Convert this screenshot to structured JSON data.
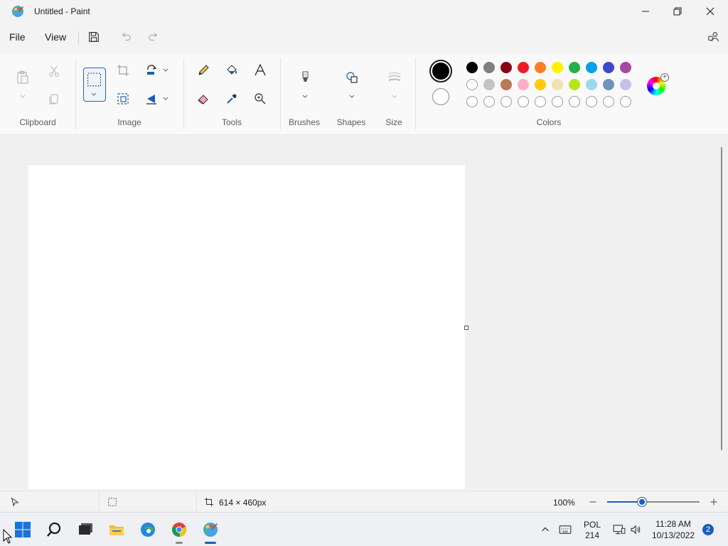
{
  "window": {
    "title": "Untitled - Paint"
  },
  "menu": {
    "file": "File",
    "view": "View"
  },
  "ribbon": {
    "groups": {
      "clipboard": "Clipboard",
      "image": "Image",
      "tools": "Tools",
      "brushes": "Brushes",
      "shapes": "Shapes",
      "size": "Size",
      "colors": "Colors"
    }
  },
  "colors": {
    "primary": "#000000",
    "secondary": "#ffffff",
    "row1": [
      "#000000",
      "#7f7f7f",
      "#880015",
      "#ed1c24",
      "#ff7f27",
      "#fff200",
      "#22b14c",
      "#00a2e8",
      "#3f48cc",
      "#a349a4"
    ],
    "row2": [
      "#ffffff",
      "#c3c3c3",
      "#b97a57",
      "#ffaec9",
      "#ffc90e",
      "#efe4b0",
      "#b5e61d",
      "#99d9ea",
      "#7092be",
      "#c8bfe7"
    ],
    "custom_slots": 10
  },
  "status": {
    "canvas_size": "614 × 460px",
    "zoom": "100%",
    "zoom_slider_fraction": 0.38
  },
  "taskbar": {
    "language_top": "POL",
    "language_bottom": "214",
    "time": "11:28 AM",
    "date": "10/13/2022",
    "notifications": "2"
  },
  "icons": {
    "app": "paint-icon",
    "minimize": "minimize-icon",
    "maximize": "restore-icon",
    "close": "close-icon"
  }
}
